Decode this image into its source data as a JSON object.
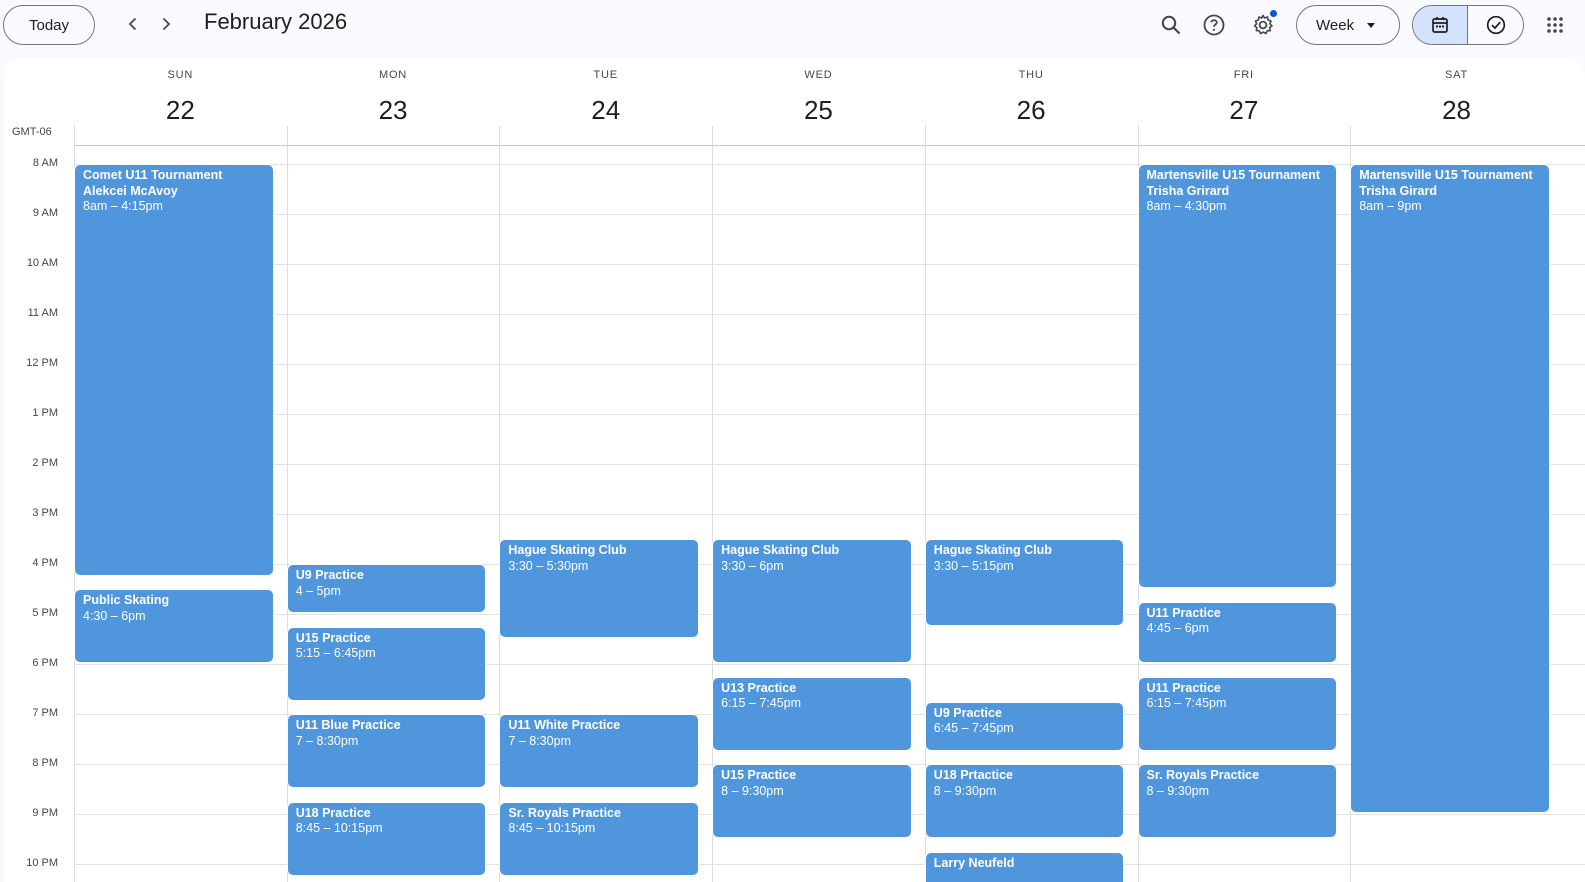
{
  "toolbar": {
    "today_label": "Today",
    "month_title": "February 2026",
    "view_label": "Week"
  },
  "icons": {
    "prev": "chevron-left-icon",
    "next": "chevron-right-icon",
    "search": "search-icon",
    "help": "help-icon",
    "settings": "gear-icon",
    "calendar": "calendar-icon",
    "tasks": "check-circle-icon",
    "apps": "apps-grid-icon"
  },
  "colors": {
    "event": "#4f96dc",
    "accent": "#0b57d0",
    "toggle_active": "#d3e3fd"
  },
  "timezone": "GMT-06",
  "days": [
    {
      "name": "SUN",
      "num": "22"
    },
    {
      "name": "MON",
      "num": "23"
    },
    {
      "name": "TUE",
      "num": "24"
    },
    {
      "name": "WED",
      "num": "25"
    },
    {
      "name": "THU",
      "num": "26"
    },
    {
      "name": "FRI",
      "num": "27"
    },
    {
      "name": "SAT",
      "num": "28"
    }
  ],
  "hours": [
    "8 AM",
    "9 AM",
    "10 AM",
    "11 AM",
    "12 PM",
    "1 PM",
    "2 PM",
    "3 PM",
    "4 PM",
    "5 PM",
    "6 PM",
    "7 PM",
    "8 PM",
    "9 PM",
    "10 PM"
  ],
  "events": [
    {
      "day": 0,
      "start": 8.0,
      "end": 16.25,
      "title": "Comet U11 Tournament Alekcei McAvoy",
      "time": "8am – 4:15pm"
    },
    {
      "day": 0,
      "start": 16.5,
      "end": 18.0,
      "title": "Public Skating",
      "time": "4:30 – 6pm"
    },
    {
      "day": 1,
      "start": 16.0,
      "end": 17.0,
      "title": "U9 Practice",
      "time": "4 – 5pm"
    },
    {
      "day": 1,
      "start": 17.25,
      "end": 18.75,
      "title": "U15 Practice",
      "time": "5:15 – 6:45pm"
    },
    {
      "day": 1,
      "start": 19.0,
      "end": 20.5,
      "title": "U11 Blue Practice",
      "time": "7 – 8:30pm"
    },
    {
      "day": 1,
      "start": 20.75,
      "end": 22.25,
      "title": "U18 Practice",
      "time": "8:45 – 10:15pm"
    },
    {
      "day": 2,
      "start": 15.5,
      "end": 17.5,
      "title": "Hague Skating Club",
      "time": "3:30 – 5:30pm"
    },
    {
      "day": 2,
      "start": 19.0,
      "end": 20.5,
      "title": "U11 White Practice",
      "time": "7 – 8:30pm"
    },
    {
      "day": 2,
      "start": 20.75,
      "end": 22.25,
      "title": "Sr. Royals Practice",
      "time": "8:45 – 10:15pm"
    },
    {
      "day": 3,
      "start": 15.5,
      "end": 18.0,
      "title": "Hague Skating Club",
      "time": "3:30 – 6pm"
    },
    {
      "day": 3,
      "start": 18.25,
      "end": 19.75,
      "title": "U13 Practice",
      "time": "6:15 – 7:45pm"
    },
    {
      "day": 3,
      "start": 20.0,
      "end": 21.5,
      "title": "U15 Practice",
      "time": "8 – 9:30pm"
    },
    {
      "day": 4,
      "start": 15.5,
      "end": 17.25,
      "title": "Hague Skating Club",
      "time": "3:30 – 5:15pm"
    },
    {
      "day": 4,
      "start": 18.75,
      "end": 19.75,
      "title": "U9 Practice",
      "time": "6:45 – 7:45pm"
    },
    {
      "day": 4,
      "start": 20.0,
      "end": 21.5,
      "title": "U18 Prtactice",
      "time": "8 – 9:30pm"
    },
    {
      "day": 4,
      "start": 21.75,
      "end": 23.0,
      "title": "Larry Neufeld",
      "time": ""
    },
    {
      "day": 5,
      "start": 8.0,
      "end": 16.5,
      "title": "Martensville U15 Tournament Trisha Grirard",
      "time": "8am – 4:30pm"
    },
    {
      "day": 5,
      "start": 16.75,
      "end": 18.0,
      "title": "U11 Practice",
      "time": "4:45 – 6pm"
    },
    {
      "day": 5,
      "start": 18.25,
      "end": 19.75,
      "title": "U11 Practice",
      "time": "6:15 – 7:45pm"
    },
    {
      "day": 5,
      "start": 20.0,
      "end": 21.5,
      "title": "Sr. Royals Practice",
      "time": "8 – 9:30pm"
    },
    {
      "day": 6,
      "start": 8.0,
      "end": 21.0,
      "title": "Martensville U15 Tournament Trisha Girard",
      "time": "8am – 9pm"
    }
  ]
}
